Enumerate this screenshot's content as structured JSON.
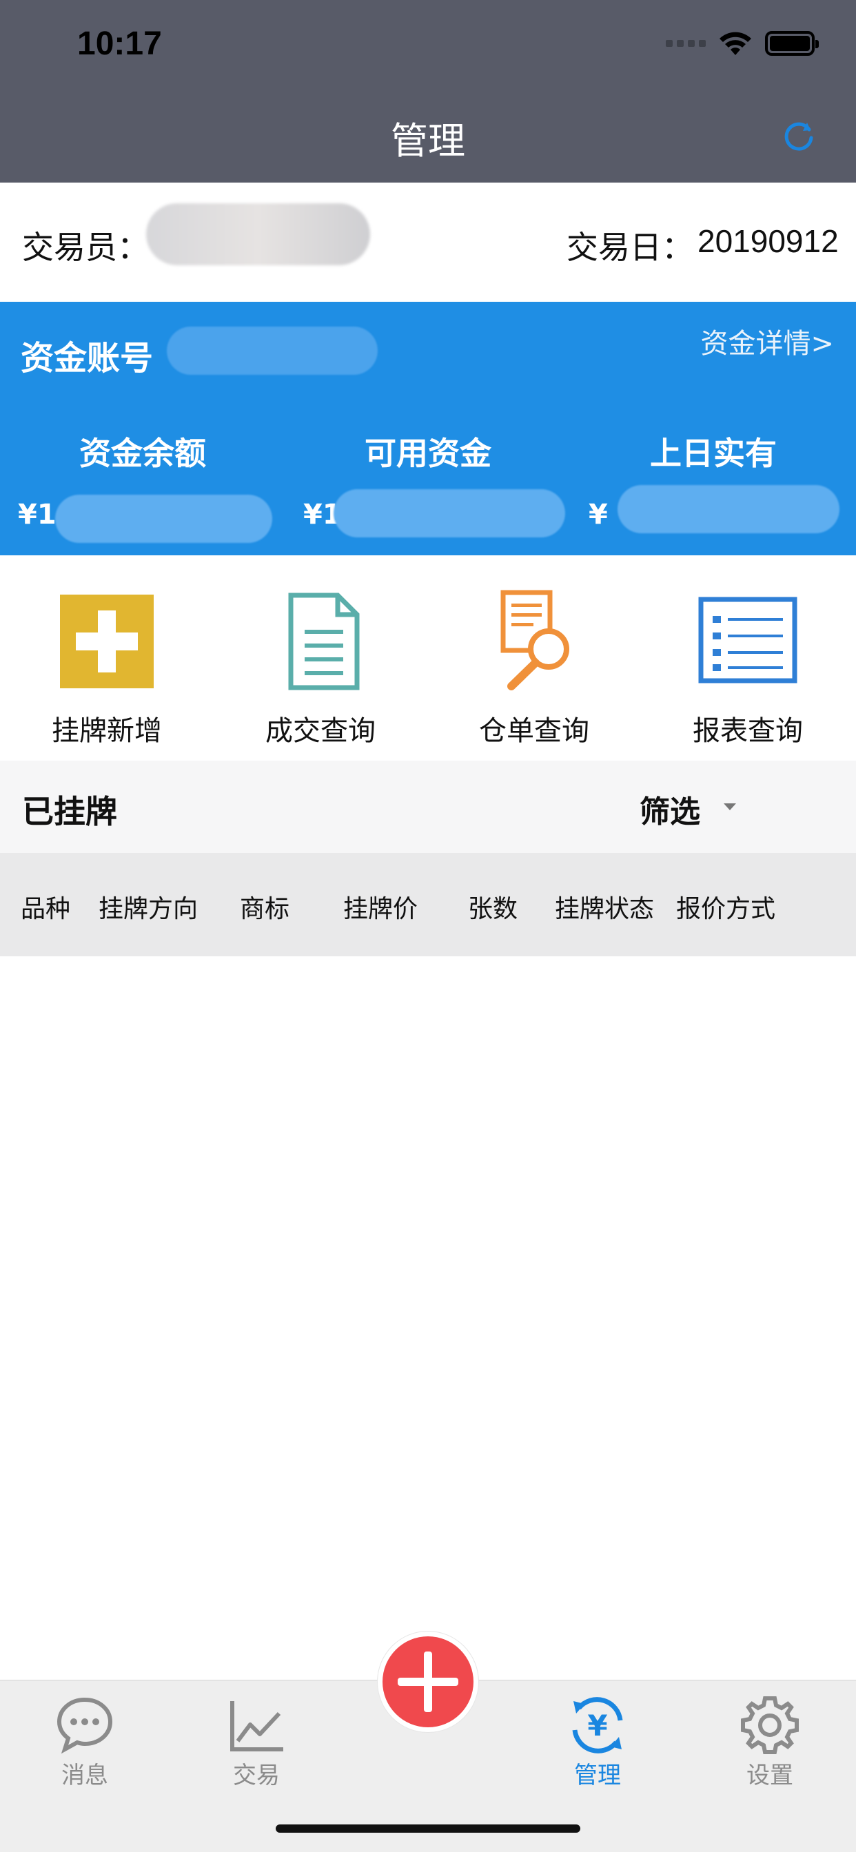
{
  "status_bar": {
    "time": "10:17"
  },
  "nav": {
    "title": "管理",
    "refresh_icon": "refresh-icon"
  },
  "trader": {
    "label": "交易员：",
    "date_label": "交易日：",
    "date_value": "20190912"
  },
  "fund": {
    "account_label": "资金账号",
    "detail_link": "资金详情>",
    "columns": [
      {
        "label": "资金余额",
        "value_prefix": "¥1"
      },
      {
        "label": "可用资金",
        "value_prefix": "¥1"
      },
      {
        "label": "上日实有",
        "value_prefix": "¥"
      }
    ]
  },
  "actions": [
    {
      "label": "挂牌新增",
      "icon": "add-listing-icon",
      "color": "#e1b630"
    },
    {
      "label": "成交查询",
      "icon": "document-icon",
      "color": "#5aaeaa"
    },
    {
      "label": "仓单查询",
      "icon": "search-document-icon",
      "color": "#f0913a"
    },
    {
      "label": "报表查询",
      "icon": "report-list-icon",
      "color": "#2f7fd6"
    }
  ],
  "listed": {
    "title": "已挂牌",
    "filter_label": "筛选"
  },
  "table": {
    "columns": [
      "品种",
      "挂牌方向",
      "商标",
      "挂牌价",
      "张数",
      "挂牌状态",
      "报价方式"
    ]
  },
  "tabbar": {
    "items": [
      {
        "label": "消息",
        "icon": "message-icon",
        "active": false
      },
      {
        "label": "交易",
        "icon": "chart-icon",
        "active": false
      },
      {
        "label": "管理",
        "icon": "yuan-refresh-icon",
        "active": true
      },
      {
        "label": "设置",
        "icon": "gear-icon",
        "active": false
      }
    ],
    "center_button_icon": "plus-icon"
  },
  "colors": {
    "header": "#585b68",
    "fund_card": "#1f8ee4",
    "accent": "#1a86e0",
    "fab": "#f0494d"
  }
}
